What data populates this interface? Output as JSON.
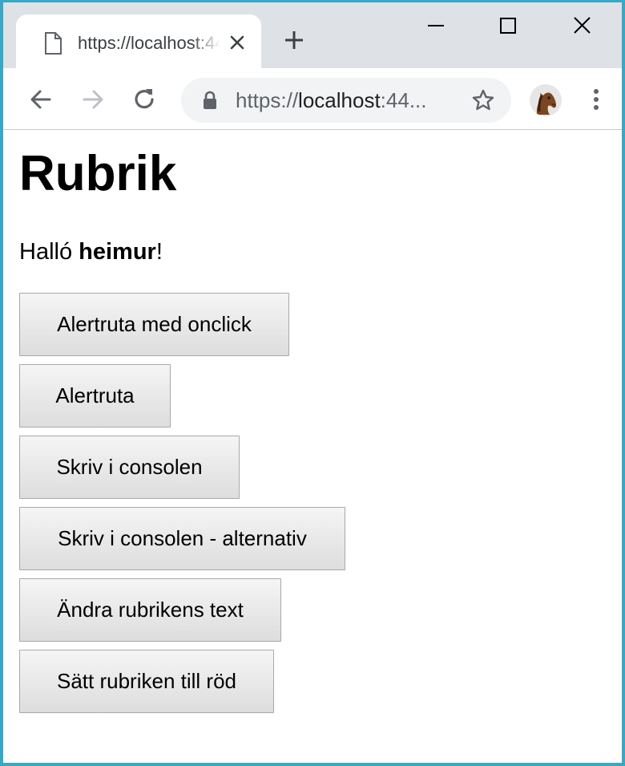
{
  "browser": {
    "tab": {
      "title": "https://localhost:44…",
      "icon": "document-icon"
    },
    "address_bar": {
      "scheme": "https://",
      "host": "localhost",
      "rest": ":44..."
    },
    "colors": {
      "frame_border": "#3aa7c4",
      "tabstrip": "#dee1e6",
      "omnibox": "#f1f3f4"
    }
  },
  "page": {
    "heading": "Rubrik",
    "greeting": {
      "prefix": "Halló ",
      "name": "heimur",
      "suffix": "!"
    },
    "buttons": [
      {
        "label": "Alertruta med onclick"
      },
      {
        "label": "Alertruta"
      },
      {
        "label": "Skriv i consolen"
      },
      {
        "label": "Skriv i consolen - alternativ"
      },
      {
        "label": "Ändra rubrikens text"
      },
      {
        "label": "Sätt rubriken till röd"
      }
    ]
  }
}
